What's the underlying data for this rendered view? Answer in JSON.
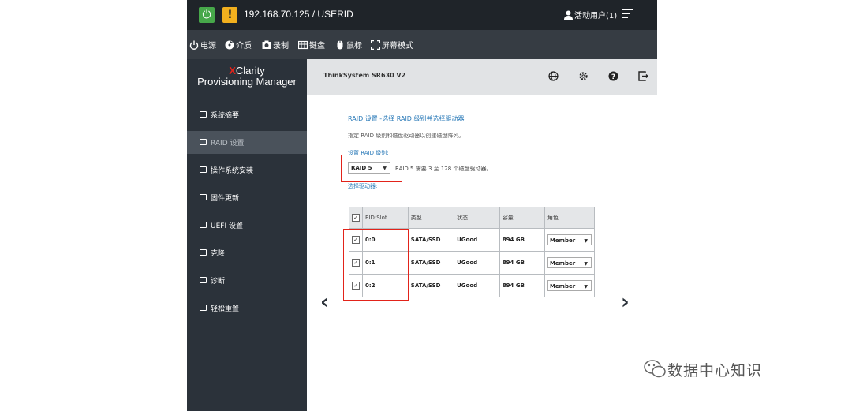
{
  "topbar": {
    "host": "192.168.70.125 / USERID",
    "user": "活动用户(1)"
  },
  "toolbar": {
    "items": [
      {
        "label": "电源",
        "icon": "power-icon"
      },
      {
        "label": "介质",
        "icon": "media-icon"
      },
      {
        "label": "录制",
        "icon": "camera-icon"
      },
      {
        "label": "键盘",
        "icon": "keyboard-icon"
      },
      {
        "label": "鼠标",
        "icon": "mouse-icon"
      },
      {
        "label": "屏幕模式",
        "icon": "fullscreen-icon"
      }
    ]
  },
  "sidebar": {
    "brand_x": "X",
    "brand_rest": "Clarity",
    "brand_sub": "Provisioning Manager",
    "items": [
      {
        "label": "系统摘要"
      },
      {
        "label": "RAID 设置"
      },
      {
        "label": "操作系统安装"
      },
      {
        "label": "固件更新"
      },
      {
        "label": "UEFI 设置"
      },
      {
        "label": "克隆"
      },
      {
        "label": "诊断"
      },
      {
        "label": "轻松重置"
      }
    ],
    "active_index": 1
  },
  "header": {
    "model": "ThinkSystem SR630 V2"
  },
  "raid": {
    "title": "RAID 设置 -选择 RAID 级别并选择驱动器",
    "description": "指定 RAID 级别和磁盘驱动器以创建磁盘阵列。",
    "level_label": "设置 RAID 级别:",
    "level_value": "RAID 5",
    "level_note": "RAID 5 需要 3 至 128 个磁盘驱动器。",
    "drives_label": "选择驱动器:",
    "columns": [
      "EID:Slot",
      "类型",
      "状态",
      "容量",
      "角色"
    ],
    "rows": [
      {
        "slot": "0:0",
        "type": "SATA/SSD",
        "state": "UGood",
        "size": "894 GB",
        "role": "Member",
        "checked": true
      },
      {
        "slot": "0:1",
        "type": "SATA/SSD",
        "state": "UGood",
        "size": "894 GB",
        "role": "Member",
        "checked": true
      },
      {
        "slot": "0:2",
        "type": "SATA/SSD",
        "state": "UGood",
        "size": "894 GB",
        "role": "Member",
        "checked": true
      }
    ]
  },
  "nav_arrows": {
    "prev": "‹",
    "next": "›"
  },
  "watermark": "数据中心知识",
  "colors": {
    "accent": "#2a7ab8",
    "highlight": "#e2231a",
    "power": "#47a84a",
    "warning": "#f2b01e"
  }
}
